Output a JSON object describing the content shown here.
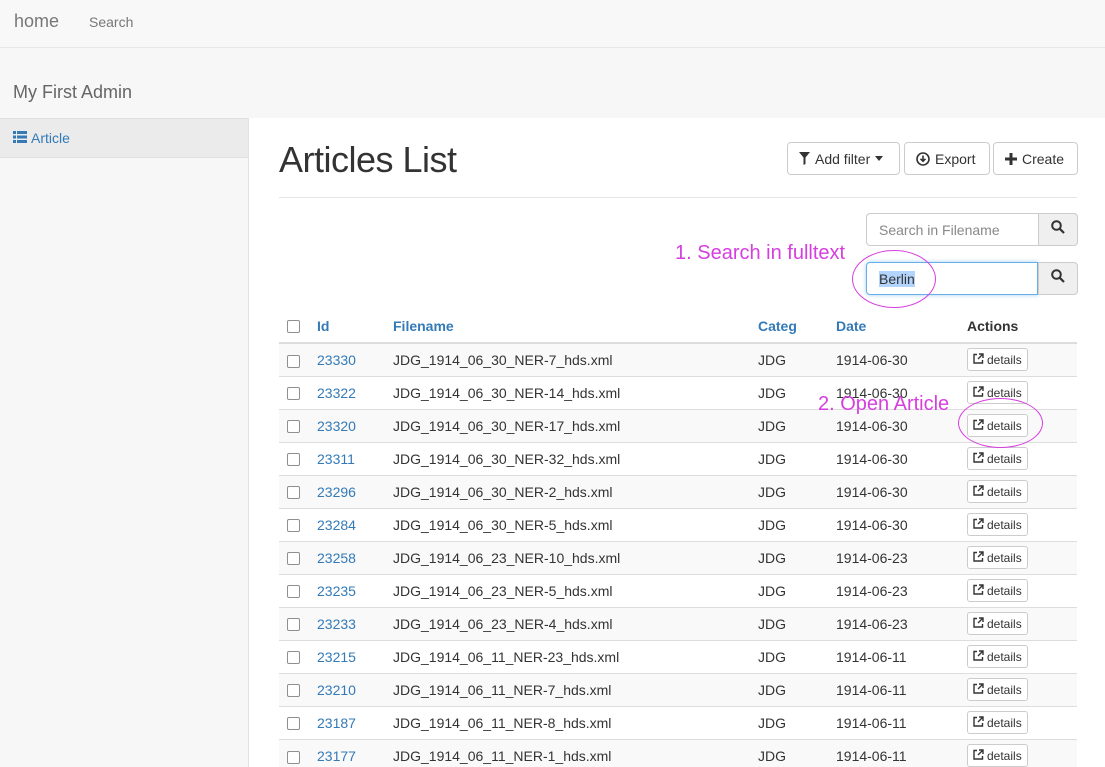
{
  "navbar": {
    "brand": "home",
    "links": [
      "Search"
    ]
  },
  "admin_title": "My First Admin",
  "sidebar": {
    "items": [
      {
        "label": "Article",
        "icon": "list-icon",
        "active": true
      }
    ]
  },
  "page": {
    "title": "Articles List"
  },
  "toolbar": {
    "add_filter_label": "Add filter",
    "export_label": "Export",
    "create_label": "Create"
  },
  "search": {
    "filename_placeholder": "Search in Filename",
    "fulltext_value": "Berlin"
  },
  "annotations": {
    "step1": "1. Search in fulltext",
    "step2": "2. Open Article",
    "color": "#d63ee0"
  },
  "table": {
    "columns": [
      "Id",
      "Filename",
      "Categ",
      "Date",
      "Actions"
    ],
    "action_label": "details",
    "rows": [
      {
        "id": "23330",
        "filename": "JDG_1914_06_30_NER-7_hds.xml",
        "categ": "JDG",
        "date": "1914-06-30"
      },
      {
        "id": "23322",
        "filename": "JDG_1914_06_30_NER-14_hds.xml",
        "categ": "JDG",
        "date": "1914-06-30"
      },
      {
        "id": "23320",
        "filename": "JDG_1914_06_30_NER-17_hds.xml",
        "categ": "JDG",
        "date": "1914-06-30"
      },
      {
        "id": "23311",
        "filename": "JDG_1914_06_30_NER-32_hds.xml",
        "categ": "JDG",
        "date": "1914-06-30"
      },
      {
        "id": "23296",
        "filename": "JDG_1914_06_30_NER-2_hds.xml",
        "categ": "JDG",
        "date": "1914-06-30"
      },
      {
        "id": "23284",
        "filename": "JDG_1914_06_30_NER-5_hds.xml",
        "categ": "JDG",
        "date": "1914-06-30"
      },
      {
        "id": "23258",
        "filename": "JDG_1914_06_23_NER-10_hds.xml",
        "categ": "JDG",
        "date": "1914-06-23"
      },
      {
        "id": "23235",
        "filename": "JDG_1914_06_23_NER-5_hds.xml",
        "categ": "JDG",
        "date": "1914-06-23"
      },
      {
        "id": "23233",
        "filename": "JDG_1914_06_23_NER-4_hds.xml",
        "categ": "JDG",
        "date": "1914-06-23"
      },
      {
        "id": "23215",
        "filename": "JDG_1914_06_11_NER-23_hds.xml",
        "categ": "JDG",
        "date": "1914-06-11"
      },
      {
        "id": "23210",
        "filename": "JDG_1914_06_11_NER-7_hds.xml",
        "categ": "JDG",
        "date": "1914-06-11"
      },
      {
        "id": "23187",
        "filename": "JDG_1914_06_11_NER-8_hds.xml",
        "categ": "JDG",
        "date": "1914-06-11"
      },
      {
        "id": "23177",
        "filename": "JDG_1914_06_11_NER-1_hds.xml",
        "categ": "JDG",
        "date": "1914-06-11"
      }
    ]
  }
}
